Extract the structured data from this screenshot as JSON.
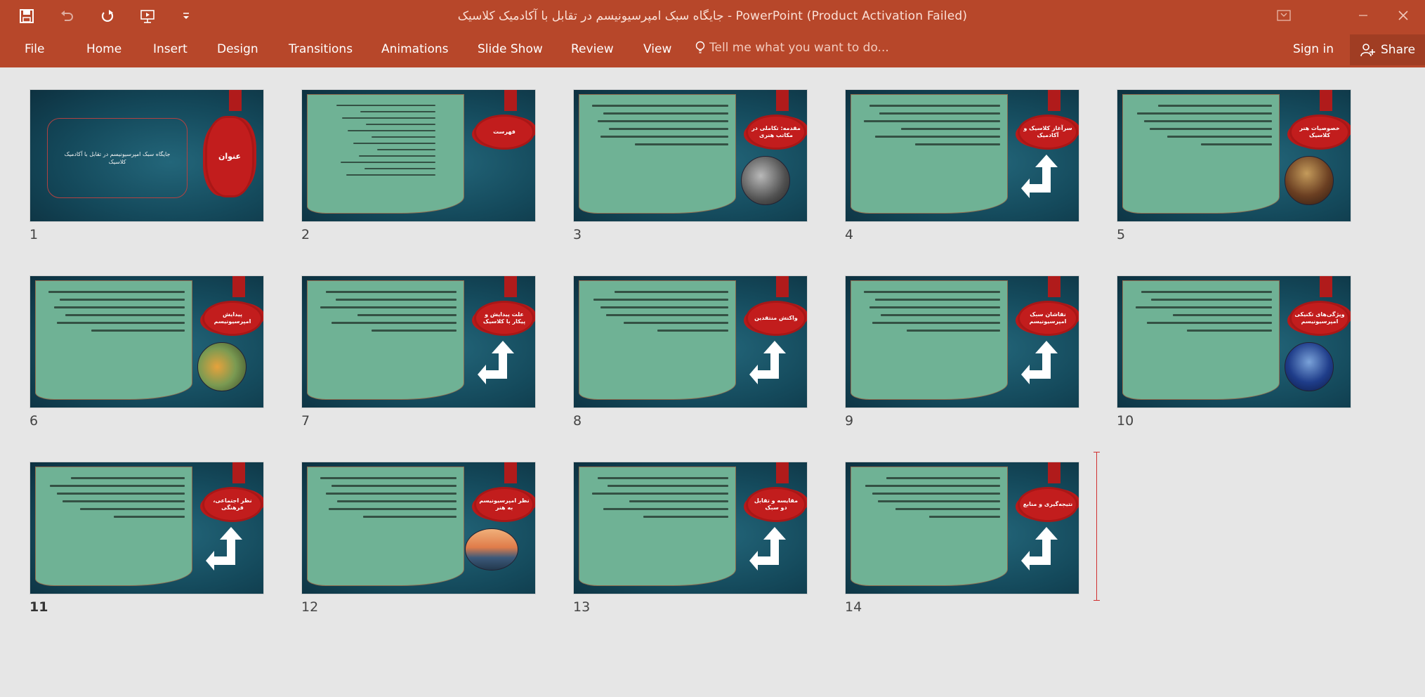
{
  "window": {
    "title": "جایگاه سبک امپرسیونیسم در تقابل با آکادمیک کلاسیک - PowerPoint (Product Activation Failed)"
  },
  "quick_access": {
    "icons": [
      "save-icon",
      "undo-icon",
      "redo-icon",
      "start-from-beginning-icon",
      "customize-toolbar-icon"
    ]
  },
  "ribbon": {
    "tabs": [
      "File",
      "Home",
      "Insert",
      "Design",
      "Transitions",
      "Animations",
      "Slide Show",
      "Review",
      "View"
    ],
    "tell_me": "Tell me what you want to do...",
    "sign_in": "Sign in",
    "share": "Share"
  },
  "colors": {
    "accent": "#b7472a",
    "slide_bg": "#14495b",
    "textbox": "#6fb295",
    "badge": "#c21d1d"
  },
  "slides": [
    {
      "number": "1",
      "title": "عنوان",
      "body": "جایگاه سبک امپرسیونیسم در تقابل با آکادمیک کلاسیک",
      "variant": "title"
    },
    {
      "number": "2",
      "title": "فهرست",
      "body": "مقدمه، مکاتب هنری دوره مدرن، سبک امپرسیونیسم، آکادمیک کلاسیک",
      "variant": "list"
    },
    {
      "number": "3",
      "title": "مقدمه: تکاملی در مکاتب هنری",
      "body": "",
      "variant": "photo"
    },
    {
      "number": "4",
      "title": "سرآغاز کلاسیک و آکادمیک",
      "body": "",
      "variant": "arrow"
    },
    {
      "number": "5",
      "title": "خصوصیات هنر کلاسیک",
      "body": "",
      "variant": "photo"
    },
    {
      "number": "6",
      "title": "پیدایش امپرسیونیسم",
      "body": "",
      "variant": "photo"
    },
    {
      "number": "7",
      "title": "علت پیدایش و پیکار با کلاسیک",
      "body": "",
      "variant": "arrow"
    },
    {
      "number": "8",
      "title": "واکنش منتقدین",
      "body": "",
      "variant": "arrow"
    },
    {
      "number": "9",
      "title": "نقاشان سبک امپرسیونیسم",
      "body": "",
      "variant": "arrow"
    },
    {
      "number": "10",
      "title": "ویژگی‌های تکنیکی امپرسیونیسم",
      "body": "",
      "variant": "photo"
    },
    {
      "number": "11",
      "title": "نظر اجتماعی، فرهنگی",
      "body": "",
      "variant": "arrow"
    },
    {
      "number": "12",
      "title": "نظر امپرسیونیسم به هنر",
      "body": "",
      "variant": "photo-wide"
    },
    {
      "number": "13",
      "title": "مقایسه و تقابل دو سبک",
      "body": "",
      "variant": "arrow"
    },
    {
      "number": "14",
      "title": "نتیجه‌گیری و منابع",
      "body": "",
      "variant": "arrow"
    }
  ]
}
